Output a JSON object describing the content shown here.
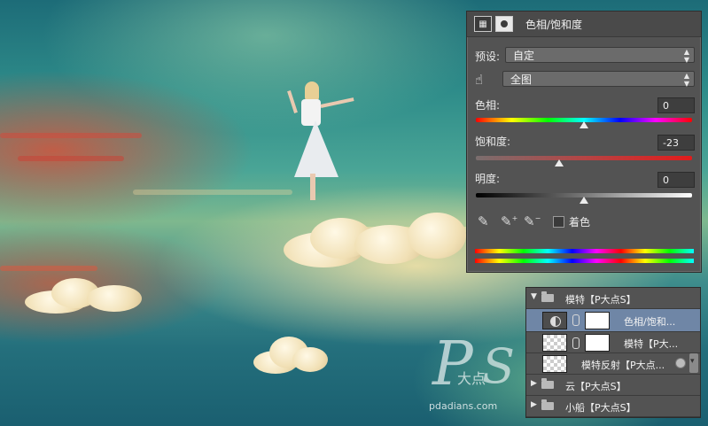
{
  "adjustment_panel": {
    "title": "色相/饱和度",
    "preset_label": "预设:",
    "preset_value": "自定",
    "channel_value": "全图",
    "hue_label": "色相:",
    "hue_value": "0",
    "saturation_label": "饱和度:",
    "saturation_value": "-23",
    "lightness_label": "明度:",
    "lightness_value": "0",
    "colorize_label": "着色",
    "colorize_checked": false,
    "slider_levels": {
      "hue": 0,
      "saturation": -23,
      "lightness": 0,
      "min": -100,
      "max": 100,
      "hue_min": -180,
      "hue_max": 180
    }
  },
  "layers_panel": {
    "rows": [
      {
        "name": "模特【P大点S】",
        "kind": "group-open"
      },
      {
        "name": "色相/饱和...",
        "kind": "adjustment",
        "selected": true
      },
      {
        "name": "模特【P大...",
        "kind": "pixel"
      },
      {
        "name": "模特反射【P大点...",
        "kind": "pixel-fx"
      },
      {
        "name": "云【P大点S】",
        "kind": "group-closed"
      },
      {
        "name": "小船【P大点S】",
        "kind": "group-closed"
      }
    ]
  },
  "watermark": {
    "mark": "P",
    "mark2": "S",
    "chinese": "大点",
    "url": "pdadians.com"
  },
  "icons": {
    "adjustment": "hue-sat-layer-icon",
    "mask": "mask-icon",
    "targeted_adjust": "hand-icon",
    "eyedropper": "eyedropper-icon",
    "eyedropper_add": "eyedropper-plus-icon",
    "eyedropper_subtract": "eyedropper-minus-icon",
    "folder": "folder-icon",
    "fx": "layer-effect-icon"
  },
  "colors": {
    "panel_bg": "#535353",
    "selected_row": "#6f86a6"
  }
}
